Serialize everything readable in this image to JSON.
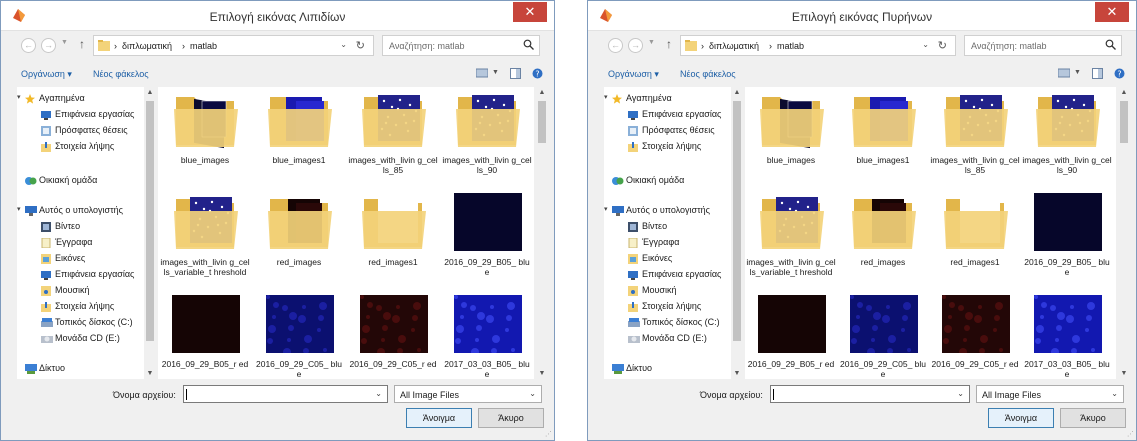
{
  "dialogs": [
    {
      "title": "Επιλογή εικόνας Λιπιδίων",
      "close_glyph": "✕",
      "breadcrumb": [
        "διπλωματική",
        "matlab"
      ],
      "crumb_sep": "›",
      "search_placeholder": "Αναζήτηση: matlab",
      "organize": "Οργάνωση",
      "new_folder": "Νέος φάκελος",
      "tree": {
        "favorites": "Αγαπημένα",
        "desktop": "Επιφάνεια εργασίας",
        "recent": "Πρόσφατες θέσεις",
        "downloads": "Στοιχεία λήψης",
        "homegroup": "Οικιακή ομάδα",
        "computer": "Αυτός ο υπολογιστής",
        "videos": "Βίντεο",
        "documents": "Έγγραφα",
        "pictures": "Εικόνες",
        "desktop2": "Επιφάνεια εργασίας",
        "music": "Μουσική",
        "downloads2": "Στοιχεία λήψης",
        "local_disk": "Τοπικός δίσκος (C:)",
        "cd_drive": "Μονάδα CD (E:)",
        "network": "Δίκτυο"
      },
      "files": [
        {
          "name": "blue_images",
          "kind": "folder-blue-image"
        },
        {
          "name": "blue_images1",
          "kind": "folder-blue"
        },
        {
          "name": "images_with_living_cells_85",
          "label": "images_with_livin g_cells_85",
          "kind": "folder-cells"
        },
        {
          "name": "images_with_living_cells_90",
          "label": "images_with_livin g_cells_90",
          "kind": "folder-cells"
        },
        {
          "name": "images_with_living_cells_variable_threshold",
          "label": "images_with_livin g_cells_variable_t hreshold",
          "kind": "folder-cells"
        },
        {
          "name": "red_images",
          "kind": "folder-red"
        },
        {
          "name": "red_images1",
          "kind": "folder-plain"
        },
        {
          "name": "2016_09_29_B05_blue",
          "label": "2016_09_29_B05_ blue",
          "kind": "image-dark-blue"
        },
        {
          "name": "2016_09_29_B05_red",
          "label": "2016_09_29_B05_r ed",
          "kind": "image-dark-red"
        },
        {
          "name": "2016_09_29_C05_blue",
          "label": "2016_09_29_C05_ blue",
          "kind": "image-blue"
        },
        {
          "name": "2016_09_29_C05_red",
          "label": "2016_09_29_C05_r ed",
          "kind": "image-red"
        },
        {
          "name": "2017_03_03_B05_blue",
          "label": "2017_03_03_B05_ blue",
          "kind": "image-bright-blue"
        }
      ],
      "filename_label": "Όνομα αρχείου:",
      "filename_value": "",
      "filter": "All Image Files",
      "open": "Άνοιγμα",
      "cancel": "Άκυρο"
    },
    {
      "title": "Επιλογή εικόνας Πυρήνων",
      "close_glyph": "✕",
      "breadcrumb": [
        "διπλωματική",
        "matlab"
      ],
      "crumb_sep": "›",
      "search_placeholder": "Αναζήτηση: matlab",
      "organize": "Οργάνωση",
      "new_folder": "Νέος φάκελος",
      "tree": {
        "favorites": "Αγαπημένα",
        "desktop": "Επιφάνεια εργασίας",
        "recent": "Πρόσφατες θέσεις",
        "downloads": "Στοιχεία λήψης",
        "homegroup": "Οικιακή ομάδα",
        "computer": "Αυτός ο υπολογιστής",
        "videos": "Βίντεο",
        "documents": "Έγγραφα",
        "pictures": "Εικόνες",
        "desktop2": "Επιφάνεια εργασίας",
        "music": "Μουσική",
        "downloads2": "Στοιχεία λήψης",
        "local_disk": "Τοπικός δίσκος (C:)",
        "cd_drive": "Μονάδα CD (E:)",
        "network": "Δίκτυο"
      },
      "files": [
        {
          "name": "blue_images",
          "kind": "folder-blue-image"
        },
        {
          "name": "blue_images1",
          "kind": "folder-blue"
        },
        {
          "name": "images_with_living_cells_85",
          "label": "images_with_livin g_cells_85",
          "kind": "folder-cells"
        },
        {
          "name": "images_with_living_cells_90",
          "label": "images_with_livin g_cells_90",
          "kind": "folder-cells"
        },
        {
          "name": "images_with_living_cells_variable_threshold",
          "label": "images_with_livin g_cells_variable_t hreshold",
          "kind": "folder-cells"
        },
        {
          "name": "red_images",
          "kind": "folder-red"
        },
        {
          "name": "red_images1",
          "kind": "folder-plain"
        },
        {
          "name": "2016_09_29_B05_blue",
          "label": "2016_09_29_B05_ blue",
          "kind": "image-dark-blue"
        },
        {
          "name": "2016_09_29_B05_red",
          "label": "2016_09_29_B05_r ed",
          "kind": "image-dark-red"
        },
        {
          "name": "2016_09_29_C05_blue",
          "label": "2016_09_29_C05_ blue",
          "kind": "image-blue"
        },
        {
          "name": "2016_09_29_C05_red",
          "label": "2016_09_29_C05_r ed",
          "kind": "image-red"
        },
        {
          "name": "2017_03_03_B05_blue",
          "label": "2017_03_03_B05_ blue",
          "kind": "image-bright-blue"
        }
      ],
      "filename_label": "Όνομα αρχείου:",
      "filename_value": "",
      "filter": "All Image Files",
      "open": "Άνοιγμα",
      "cancel": "Άκυρο"
    }
  ],
  "colors": {
    "close": "#c7453b",
    "link": "#1d5fa6",
    "folder": "#f3d37a",
    "folder_dark": "#e2b64a",
    "blue_image": "#0c0e6a",
    "red_image": "#2a0808"
  },
  "icons": [
    "matlab-icon",
    "back-icon",
    "forward-icon",
    "up-arrow-icon",
    "folder-icon",
    "refresh-icon",
    "search-icon",
    "view-icon",
    "preview-pane-icon",
    "help-icon",
    "star-icon",
    "desktop-icon",
    "recent-icon",
    "download-icon",
    "homegroup-icon",
    "computer-icon",
    "video-icon",
    "documents-icon",
    "pictures-icon",
    "music-icon",
    "disk-icon",
    "cd-icon",
    "network-icon"
  ]
}
